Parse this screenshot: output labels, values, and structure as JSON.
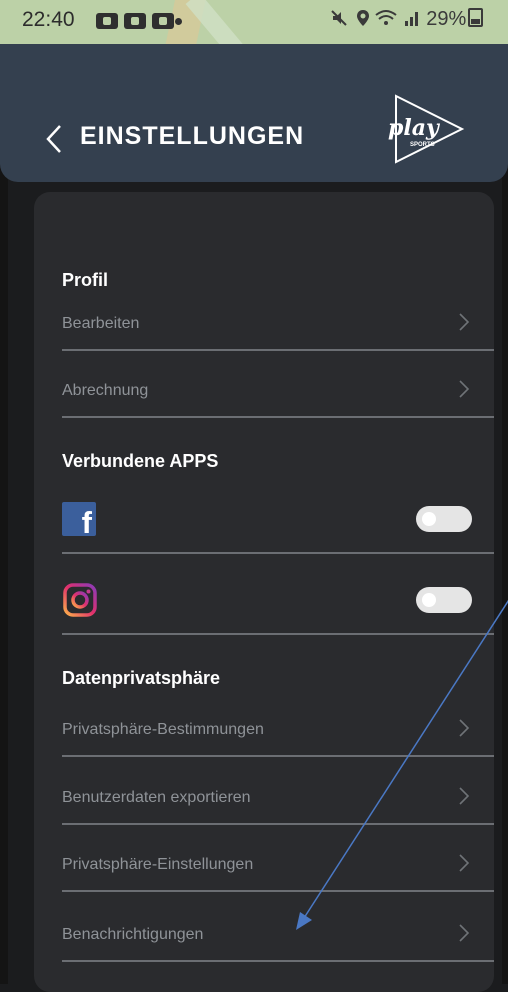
{
  "status_bar": {
    "time": "22:40",
    "battery": "29%",
    "icons": [
      "mute-icon",
      "location-icon",
      "wifi-icon",
      "signal-icon",
      "battery-icon"
    ]
  },
  "header": {
    "title": "EINSTELLUNGEN",
    "back_icon": "chevron-left-icon",
    "logo_text": "play",
    "logo_subtext": "SPORTS"
  },
  "sections": {
    "profile": {
      "title": "Profil",
      "edit": "Bearbeiten",
      "billing": "Abrechnung"
    },
    "connected_apps": {
      "title": "Verbundene APPS",
      "facebook_icon": "facebook-icon",
      "instagram_icon": "instagram-icon",
      "facebook_enabled": false,
      "instagram_enabled": false
    },
    "privacy": {
      "title": "Datenprivatsphäre",
      "terms": "Privatsphäre-Bestimmungen",
      "export": "Benutzerdaten exportieren",
      "settings": "Privatsphäre-Einstellungen",
      "notifications": "Benachrichtigungen"
    }
  },
  "colors": {
    "header_bg": "#34404f",
    "card_bg": "#2a2b2e",
    "page_bg": "#1b1c1e",
    "annotation_arrow": "#4a78c4"
  }
}
